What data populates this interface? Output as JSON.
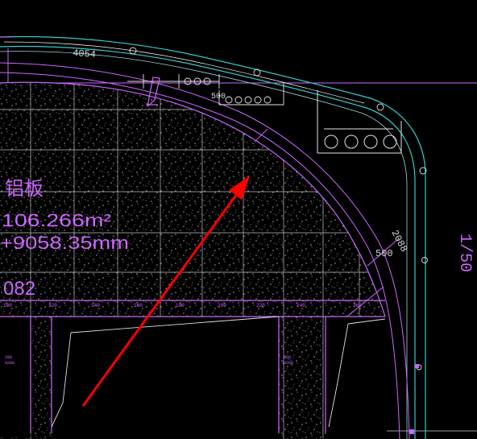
{
  "colors": {
    "background": "#000000",
    "panel_outline": "#cc66ff",
    "panel_grid": "#cfcfcf",
    "speckle": "#ffffff",
    "keel_inner": "#33cccc",
    "keel_outer": "#a0d8e0",
    "arrow": "#ff0000",
    "label_text": "#cc66ff",
    "dim_text": "#d8d8d8",
    "white_line": "#ffffff",
    "bracket": "#e6e6e6"
  },
  "annotations": {
    "material": "铝板",
    "area": "106.266m²",
    "length": "+9058.35mm",
    "partial_code": "082",
    "dim_top": "4054",
    "dim_seg_upper": "500",
    "dim_seg_right": "500",
    "dim_diag": "2088",
    "right_edge_partial": "1/50"
  },
  "icons": {
    "arrow": "red-direction-arrow-icon",
    "bracket_upper": "bracket-with-bolts-icon",
    "bracket_right": "bracket-with-bolts-icon",
    "fixing_clip": "fixing-clip-icon"
  }
}
